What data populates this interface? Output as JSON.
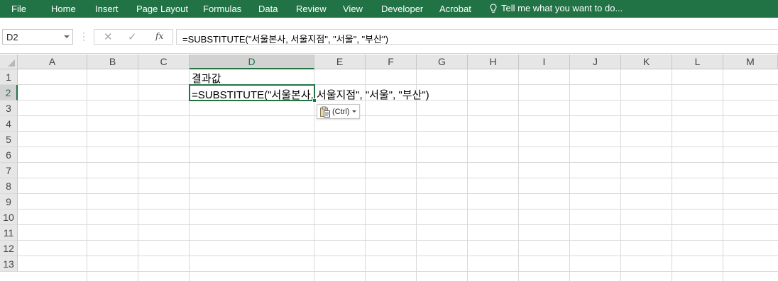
{
  "ribbon": {
    "tabs": [
      {
        "label": "File"
      },
      {
        "label": "Home"
      },
      {
        "label": "Insert"
      },
      {
        "label": "Page Layout"
      },
      {
        "label": "Formulas"
      },
      {
        "label": "Data"
      },
      {
        "label": "Review"
      },
      {
        "label": "View"
      },
      {
        "label": "Developer"
      },
      {
        "label": "Acrobat"
      }
    ],
    "tell_me": "Tell me what you want to do..."
  },
  "formula_bar": {
    "name_box": "D2",
    "cancel_symbol": "✕",
    "enter_symbol": "✓",
    "fx_label": "fx",
    "formula": "=SUBSTITUTE(\"서울본사, 서울지점\", \"서울\", \"부산\")"
  },
  "grid": {
    "columns": [
      "A",
      "B",
      "C",
      "D",
      "E",
      "F",
      "G",
      "H",
      "I",
      "J",
      "K",
      "L",
      "M"
    ],
    "rows": [
      "1",
      "2",
      "3",
      "4",
      "5",
      "6",
      "7",
      "8",
      "9",
      "10",
      "11",
      "12",
      "13"
    ],
    "selected_column": "D",
    "selected_row": "2",
    "cells": {
      "D1": "결과값",
      "D2": "=SUBSTITUTE(\"서울본사, 서울지점\", \"서울\", \"부산\")"
    }
  },
  "paste_options": {
    "label": "(Ctrl)"
  },
  "colors": {
    "ribbon": "#217346",
    "selection": "#217346",
    "header_bg": "#e6e6e6",
    "gridline": "#d9d9d9"
  }
}
